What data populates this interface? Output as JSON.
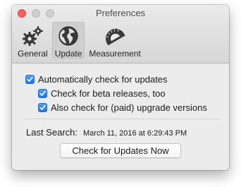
{
  "window": {
    "title": "Preferences"
  },
  "toolbar": {
    "items": [
      {
        "label": "General",
        "icon": "gears-icon",
        "selected": false
      },
      {
        "label": "Update",
        "icon": "globe-icon",
        "selected": true
      },
      {
        "label": "Measurement",
        "icon": "protractor-icon",
        "selected": false
      }
    ]
  },
  "update": {
    "auto_check": {
      "label": "Automatically check for updates",
      "checked": true
    },
    "beta": {
      "label": "Check for beta releases, too",
      "checked": true
    },
    "paid": {
      "label": "Also check for (paid) upgrade versions",
      "checked": true
    },
    "last_search_label": "Last Search:",
    "last_search_value": "March 11, 2016 at 6:29:43 PM",
    "check_button": "Check for Updates Now"
  },
  "colors": {
    "close_light": "#fc605b",
    "checkbox_accent": "#1a72f5"
  }
}
